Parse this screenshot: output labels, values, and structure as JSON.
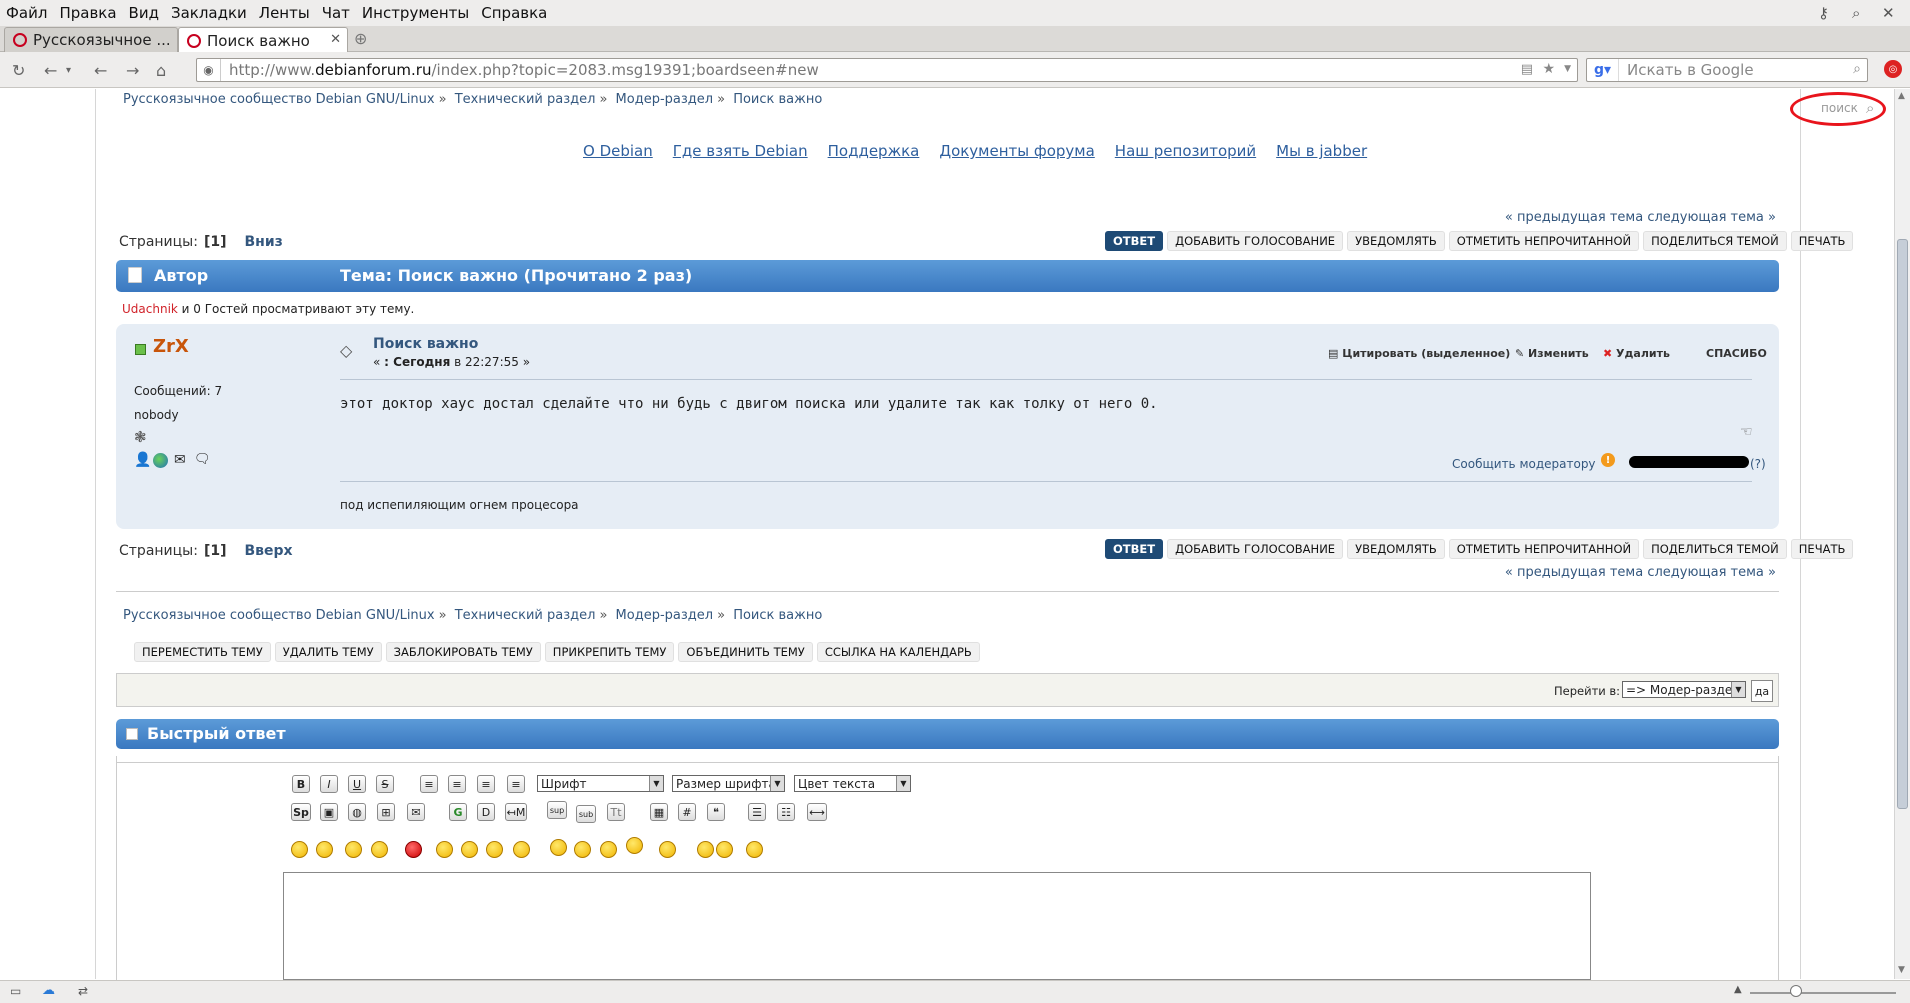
{
  "browser": {
    "menu": [
      "Файл",
      "Правка",
      "Вид",
      "Закладки",
      "Ленты",
      "Чат",
      "Инструменты",
      "Справка"
    ],
    "tabs": [
      {
        "label": "Русскоязычное ..."
      },
      {
        "label": "Поиск важно"
      }
    ],
    "url_prefix": "http://www.",
    "url_domain": "debianforum.ru",
    "url_rest": "/index.php?topic=2083.msg19391;boardseen#new",
    "search_placeholder": "Искать в Google"
  },
  "breadcrumb": [
    "Русскоязычное сообщество Debian GNU/Linux",
    "Технический раздел",
    "Модер-раздел",
    "Поиск важно"
  ],
  "site_search_label": "поиск",
  "nav_links": [
    "О Debian",
    "Где взять Debian",
    "Поддержка",
    "Документы форума",
    "Наш репозиторий",
    "Мы в jabber"
  ],
  "prev_next": "« предыдущая тема следующая тема »",
  "pages": {
    "label": "Страницы:",
    "current": "[1]",
    "down": "Вниз",
    "up": "Вверх"
  },
  "topic_buttons": [
    "ОТВЕТ",
    "ДОБАВИТЬ ГОЛОСОВАНИЕ",
    "УВЕДОМЛЯТЬ",
    "ОТМЕТИТЬ НЕПРОЧИТАННОЙ",
    "ПОДЕЛИТЬСЯ ТЕМОЙ",
    "ПЕЧАТЬ"
  ],
  "header": {
    "author": "Автор",
    "topic": "Тема: Поиск важно  (Прочитано 2 раз)"
  },
  "viewers": {
    "user": "Udachnik",
    "rest": " и 0 Гостей просматривают эту тему."
  },
  "post": {
    "author": "ZrX",
    "messages": "Сообщений: 7",
    "rank": "nobody",
    "title": "Поиск важно",
    "date_prefix": "« ",
    "date_bold": ": Сегодня",
    "date_rest": " в 22:27:55 »",
    "quote": "Цитировать (выделенное)",
    "edit": "Изменить",
    "delete": "Удалить",
    "thanks": "СПАСИБО",
    "body": "этот доктор хаус достал сделайте что ни будь с двигом поиска или удалите так как толку от него 0.",
    "report": "Сообщить модератору",
    "ip_hint": "(?)",
    "signature": "под испепиляющим огнем процесора"
  },
  "mod_buttons": [
    "ПЕРЕМЕСТИТЬ ТЕМУ",
    "УДАЛИТЬ ТЕМУ",
    "ЗАБЛОКИРОВАТЬ ТЕМУ",
    "ПРИКРЕПИТЬ ТЕМУ",
    "ОБЪЕДИНИТЬ ТЕМУ",
    "ССЫЛКА НА КАЛЕНДАРЬ"
  ],
  "jump": {
    "label": "Перейти в:",
    "value": "=> Модер-раздел",
    "go": "да"
  },
  "quick_reply": {
    "title": "Быстрый ответ",
    "font_select": "Шрифт",
    "size_select": "Размер шрифта",
    "color_select": "Цвет текста"
  },
  "colors": {
    "accent": "#3a78c0",
    "link": "#34577e",
    "username": "#c8550a",
    "post_bg": "#e6edf5",
    "annotation": "#e8141c"
  }
}
